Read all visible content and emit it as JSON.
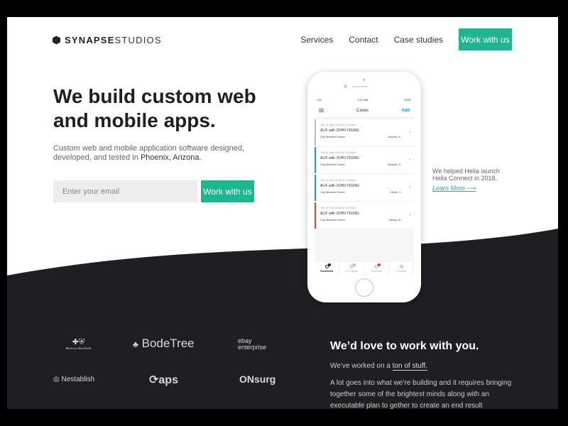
{
  "header": {
    "logo_bold": "SYNAPSE",
    "logo_light": "STUDIOS",
    "nav": [
      "Services",
      "Contact",
      "Case studies"
    ],
    "cta": "Work with us"
  },
  "hero": {
    "title": "We build custom web and mobile apps.",
    "subtitle_prefix": "Custom web and mobile application software designed, developed, and tested in ",
    "subtitle_location": "Phoenix, Arizona.",
    "email_placeholder": "Enter your email",
    "button": "Work with us"
  },
  "showcase": {
    "caption": "We helped Helia launch Helia Connect in 2018.",
    "link": "Learn More ⟶"
  },
  "phone": {
    "status": {
      "carrier": "GS",
      "time": "9:41 AM",
      "battery": "100%"
    },
    "title": "Cases",
    "add": "Add",
    "cases": [
      {
        "date": "Tue, 8 Sep 2018 at 12:30pm",
        "name": "ALIF with JOHN YEUNG",
        "location": "City Medical Center",
        "doctor": "Mucino, A.",
        "color": "#bbbbbb"
      },
      {
        "date": "Tue, 8 Sep 2018 at 12:30pm",
        "name": "ALIF with JOHN YEUNG",
        "location": "City Medical Center",
        "doctor": "Stewart, S.",
        "color": "#1a9ad6"
      },
      {
        "date": "Tue, 8 Sep 2018 at 12:30pm",
        "name": "ALIF with JOHN YEUNG",
        "location": "City Medical Center",
        "doctor": "Hollis, J.",
        "color": "#1a9ad6"
      },
      {
        "date": "Tue, 8 Sep 2018 at 12:30pm",
        "name": "ALIF with JOHN YEUNG",
        "location": "City Medical Center",
        "doctor": "Saling, M.",
        "color": "#e03a3a"
      }
    ],
    "tabs": [
      {
        "label": "Scheduled",
        "active": true,
        "badge_color": "#222222"
      },
      {
        "label": "In Progress",
        "active": false,
        "badge_color": "#bbbbbb"
      },
      {
        "label": "Submitted",
        "active": false,
        "badge_color": "#e03a3a"
      },
      {
        "label": "Complete",
        "active": false,
        "badge_color": ""
      }
    ]
  },
  "clients": [
    "BlueCross BlueShield",
    "BodeTree",
    "ebay enterprise",
    "Nestablish",
    "aps",
    "ONsurg"
  ],
  "cta_section": {
    "title": "We’d love to work with you.",
    "p1_prefix": "We’ve worked on a ",
    "p1_link": "ton of stuff.",
    "p2": "A lot goes into what we’re building and it requires bringing together some of the brightest minds along with an executable plan to gether to create an end result"
  },
  "colors": {
    "accent": "#1fb58f",
    "dark": "#1f1f23",
    "link_blue": "#1a9ad6"
  }
}
